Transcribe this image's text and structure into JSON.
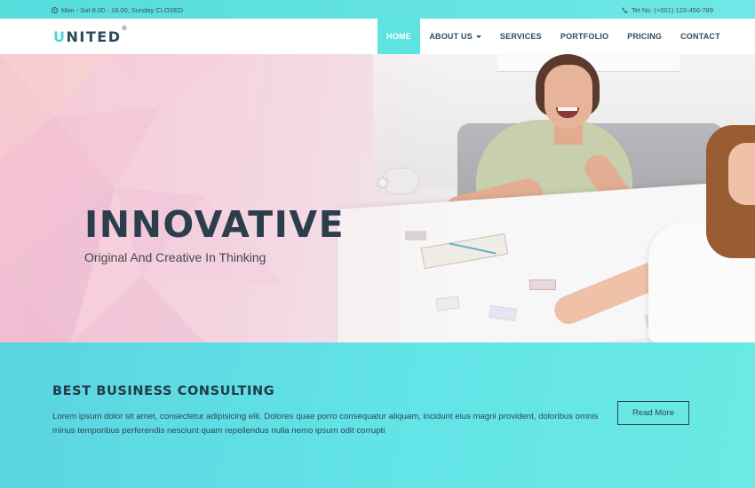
{
  "topbar": {
    "hours": "Mon - Sat 8.00 - 18.00, Sunday CLOSED",
    "phone": "Tel No. (+001) 123-456-789"
  },
  "brand": {
    "name": "UNITED",
    "name_rest": "NITED",
    "name_first": "U",
    "reg": "®"
  },
  "nav": {
    "items": [
      "HOME",
      "ABOUT US",
      "SERVICES",
      "PORTFOLIO",
      "PRICING",
      "CONTACT"
    ],
    "active": "HOME"
  },
  "hero": {
    "title": "INNOVATIVE",
    "subtitle": "Original And Creative In Thinking"
  },
  "consulting": {
    "heading": "BEST BUSINESS CONSULTING",
    "body": "Lorem ipsum dolor sit amet, consectetur adipisicing elit. Dolores quae porro consequatur aliquam, incidunt eius magni provident, doloribus omnis minus temporibus perferendis nesciunt quam repellendus nulla nemo ipsum odit corrupti",
    "button": "Read More"
  },
  "colors": {
    "accent": "#5ee3e3",
    "dark": "#2c3e4c",
    "hero_pink": "#f6c9d8"
  }
}
